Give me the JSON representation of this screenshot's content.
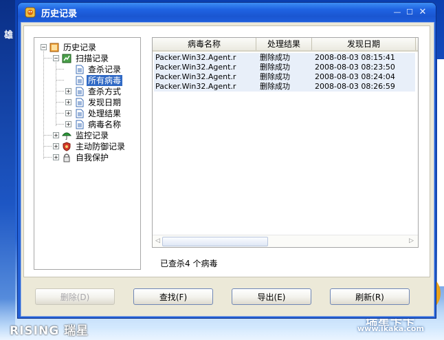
{
  "window": {
    "title": "历史记录"
  },
  "background": {
    "left_char": "雄",
    "brand_logo": "RISING 瑞星",
    "watermark_cn": "瑞星卡卡",
    "watermark_url": "www.ikaka.com"
  },
  "tree": {
    "root": {
      "label": "历史记录",
      "icon": "history-book-icon"
    },
    "scan": {
      "label": "扫描记录",
      "icon": "scan-icon"
    },
    "scan_children": [
      {
        "label": "查杀记录",
        "icon": "document-icon",
        "expandable": false
      },
      {
        "label": "所有病毒",
        "icon": "document-icon",
        "expandable": false,
        "selected": true
      },
      {
        "label": "查杀方式",
        "icon": "document-icon",
        "expandable": true
      },
      {
        "label": "发现日期",
        "icon": "document-icon",
        "expandable": true
      },
      {
        "label": "处理结果",
        "icon": "document-icon",
        "expandable": true
      },
      {
        "label": "病毒名称",
        "icon": "document-icon",
        "expandable": true
      }
    ],
    "others": [
      {
        "label": "监控记录",
        "icon": "umbrella-icon"
      },
      {
        "label": "主动防御记录",
        "icon": "shield-icon"
      },
      {
        "label": "自我保护",
        "icon": "lock-icon"
      }
    ]
  },
  "list": {
    "columns": [
      "病毒名称",
      "处理结果",
      "发现日期"
    ],
    "rows": [
      [
        "Packer.Win32.Agent.r",
        "删除成功",
        "2008-08-03 08:15:41"
      ],
      [
        "Packer.Win32.Agent.r",
        "删除成功",
        "2008-08-03 08:23:50"
      ],
      [
        "Packer.Win32.Agent.r",
        "删除成功",
        "2008-08-03 08:24:04"
      ],
      [
        "Packer.Win32.Agent.r",
        "删除成功",
        "2008-08-03 08:26:59"
      ]
    ]
  },
  "status": "已查杀4 个病毒",
  "buttons": {
    "delete": "删除(D)",
    "find": "查找(F)",
    "export": "导出(E)",
    "refresh": "刷新(R)"
  },
  "colors": {
    "title_bar": "#1f63e2",
    "selected": "#316ac5",
    "row_background": "#e8eff9",
    "client": "#ece9d8"
  }
}
